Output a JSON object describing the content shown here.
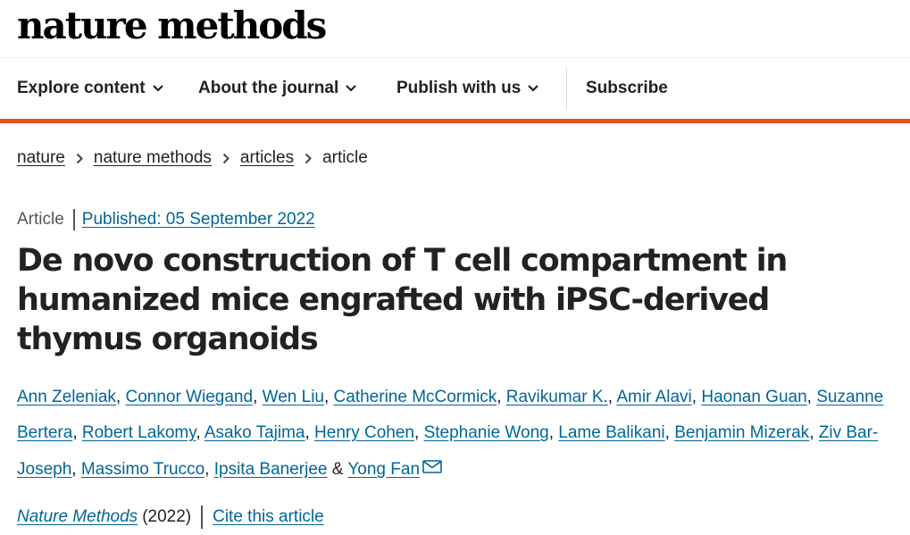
{
  "site": {
    "logo": "nature methods"
  },
  "nav": {
    "explore": "Explore content",
    "about": "About the journal",
    "publish": "Publish with us",
    "subscribe": "Subscribe"
  },
  "breadcrumb": [
    "nature",
    "nature methods",
    "articles",
    "article"
  ],
  "article": {
    "type": "Article",
    "published": "Published: 05 September 2022",
    "title": "De novo construction of T cell compartment in humanized mice engrafted with iPSC-derived thymus organoids",
    "authors": [
      "Ann Zeleniak",
      "Connor Wiegand",
      "Wen Liu",
      "Catherine McCormick",
      "Ravikumar K.",
      "Amir Alavi",
      "Haonan Guan",
      "Suzanne Bertera",
      "Robert Lakomy",
      "Asako Tajima",
      "Henry Cohen",
      "Stephanie Wong",
      "Lame Balikani",
      "Benjamin Mizerak",
      "Ziv Bar-Joseph",
      "Massimo Trucco",
      "Ipsita Banerjee",
      "Yong Fan"
    ],
    "journal": "Nature Methods",
    "year": "(2022)",
    "cite": "Cite this article"
  },
  "icons": {
    "nav_dropdown": "chevron-down-icon",
    "breadcrumb_sep": "chevron-right-icon",
    "contact": "mail-icon"
  },
  "colors": {
    "accent": "#e5531f",
    "link": "#006699",
    "text": "#222222"
  }
}
